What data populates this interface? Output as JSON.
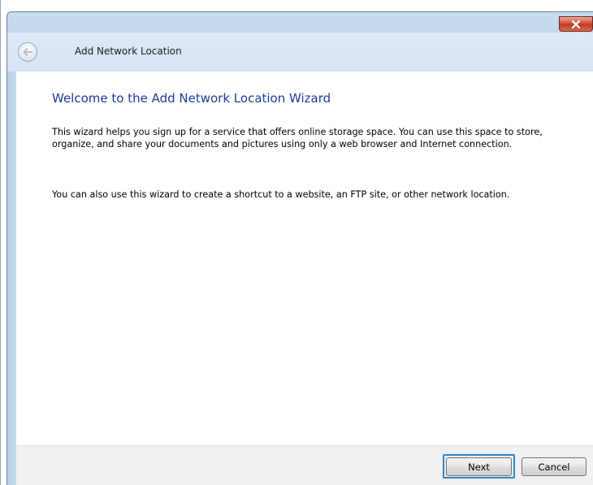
{
  "window": {
    "title": "Add Network Location"
  },
  "wizard": {
    "heading": "Welcome to the Add Network Location Wizard",
    "paragraphs": [
      "This wizard helps you sign up for a service that offers online storage space.  You can use this space to store, organize, and share your documents and pictures using only a web browser and Internet connection.",
      "You can also use this wizard to create a shortcut to a website, an FTP site, or other network location."
    ]
  },
  "buttons": {
    "next_label": "Next",
    "cancel_label": "Cancel"
  },
  "icons": {
    "back": "back-arrow-icon",
    "close": "close-icon"
  },
  "colors": {
    "heading": "#1a3d8f",
    "close_button": "#c13a26",
    "focus_ring": "#2e86c8"
  }
}
